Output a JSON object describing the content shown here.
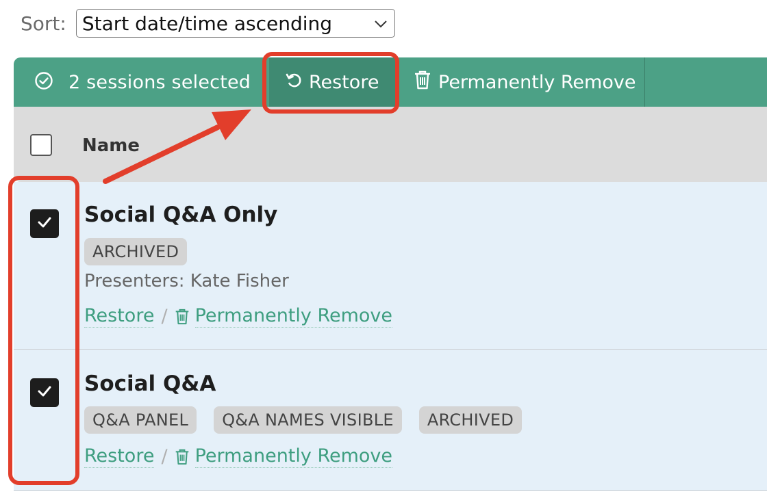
{
  "sort": {
    "label": "Sort:",
    "selected": "Start date/time ascending"
  },
  "toolbar": {
    "selected_text": "2 sessions selected",
    "restore_label": "Restore",
    "remove_label": "Permanently Remove"
  },
  "table": {
    "header_name": "Name"
  },
  "sessions": [
    {
      "name": "Social Q&A Only",
      "badges": [
        "ARCHIVED"
      ],
      "presenters": "Presenters: Kate Fisher",
      "restore_label": "Restore",
      "remove_label": "Permanently Remove",
      "checked": true
    },
    {
      "name": "Social Q&A",
      "badges": [
        "Q&A PANEL",
        "Q&A NAMES VISIBLE",
        "ARCHIVED"
      ],
      "restore_label": "Restore",
      "remove_label": "Permanently Remove",
      "checked": true
    }
  ],
  "colors": {
    "toolbar": "#4ca186",
    "toolbar_active": "#3f8a72",
    "link": "#3e9e80",
    "row_selected": "#e5f0f9",
    "annotation": "#e23e2b"
  },
  "icons": [
    "check-circle-icon",
    "restore-icon",
    "trash-icon",
    "chevron-down-icon",
    "checkmark-icon"
  ]
}
